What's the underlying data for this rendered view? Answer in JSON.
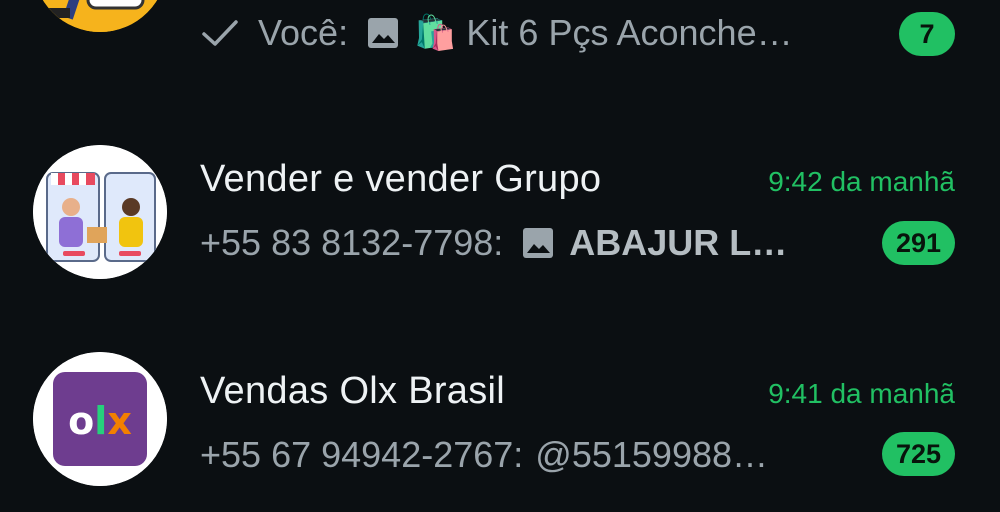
{
  "chats": [
    {
      "preview_sender": "Você:",
      "preview_icon": "image-icon",
      "preview_emoji": "🛍️",
      "preview_text": "Kit 6 Pçs Aconche…",
      "unread": "7"
    },
    {
      "title": "Vender e vender Grupo",
      "time": "9:42 da manhã",
      "preview_sender": "+55 83 8132-7798:",
      "preview_icon": "image-icon",
      "preview_text": "ABAJUR L…",
      "unread": "291"
    },
    {
      "title": "Vendas Olx Brasil",
      "time": "9:41 da manhã",
      "preview_sender": "+55 67 94942-2767:",
      "preview_text": "@55159988…",
      "unread": "725",
      "avatar_text": "OLX"
    }
  ],
  "colors": {
    "background": "#0b0f12",
    "accent": "#21c063",
    "muted_text": "#9aa4ab"
  }
}
